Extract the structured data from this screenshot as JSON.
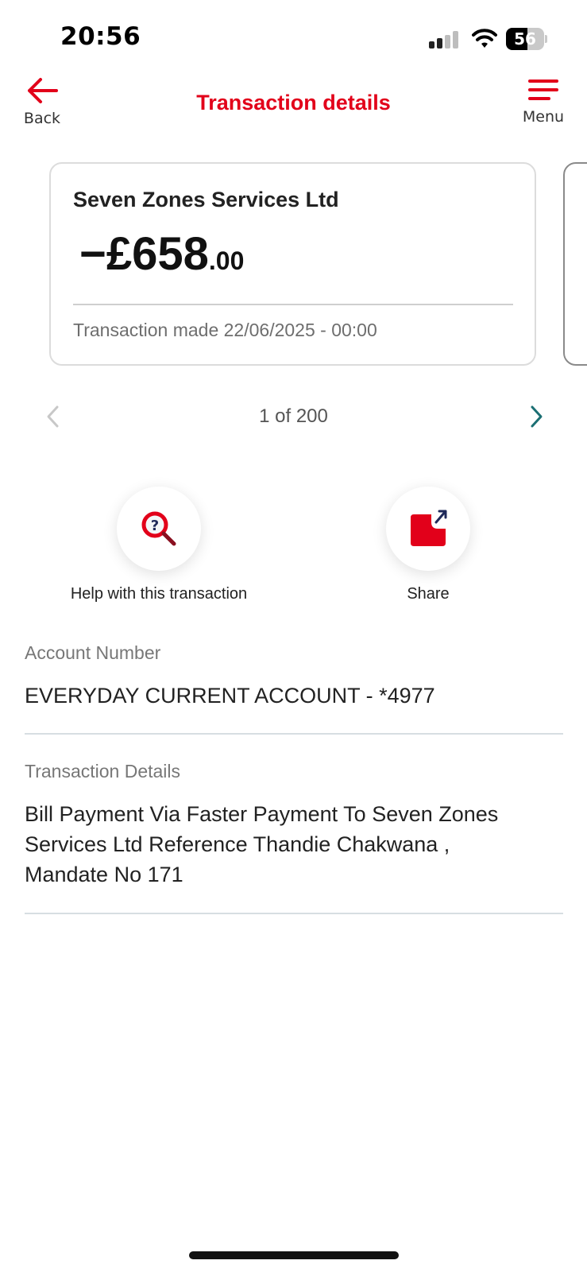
{
  "status_bar": {
    "time": "20:56",
    "battery_level": "56"
  },
  "header": {
    "back_label": "Back",
    "title": "Transaction details",
    "menu_label": "Menu"
  },
  "transaction_card": {
    "merchant": "Seven Zones Services Ltd",
    "amount_main": "−£658",
    "amount_pence": ".00",
    "transaction_made_label": "Transaction made",
    "transaction_made_date": "22/06/2025 - 00:00"
  },
  "pager": {
    "text": "1 of 200"
  },
  "actions": {
    "help_label": "Help with this transaction",
    "share_label": "Share"
  },
  "account": {
    "label": "Account Number",
    "value": "EVERYDAY CURRENT ACCOUNT - *4977"
  },
  "details": {
    "label": "Transaction Details",
    "line1": "Bill Payment Via Faster Payment To Seven Zones",
    "line2": "Services Ltd Reference Thandie Chakwana ,",
    "line3": "Mandate No 171"
  },
  "colors": {
    "brand_red": "#e2001a",
    "pager_next": "#1b6f73",
    "pager_prev_disabled": "#c8c8c8"
  }
}
